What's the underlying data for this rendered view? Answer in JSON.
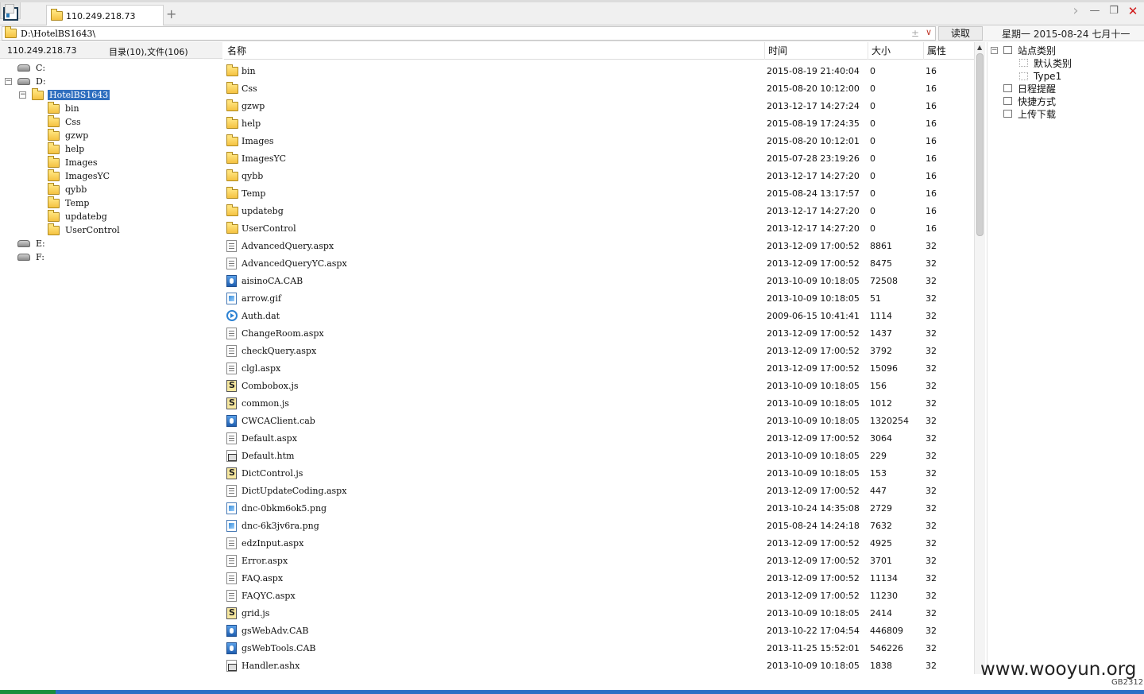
{
  "tab": {
    "title": "110.249.218.73"
  },
  "toolbar": {
    "new_tab": "+",
    "minimize": "—",
    "restore": "❐",
    "close": "✕",
    "forward": "›"
  },
  "address": {
    "path": "D:\\HotelBS1643\\",
    "star": "±",
    "dropdown": "∨",
    "read_label": "读取"
  },
  "date_line": "星期一  2015-08-24  七月十一",
  "left": {
    "host": "110.249.218.73",
    "counts": "目录(10),文件(106)",
    "tree": [
      {
        "label": "C:",
        "kind": "drive"
      },
      {
        "label": "D:",
        "kind": "drive",
        "expander": "−"
      },
      {
        "label": "HotelBS1643",
        "kind": "folder",
        "expander": "−",
        "selected": true
      },
      {
        "label": "bin",
        "kind": "folder"
      },
      {
        "label": "Css",
        "kind": "folder"
      },
      {
        "label": "gzwp",
        "kind": "folder"
      },
      {
        "label": "help",
        "kind": "folder"
      },
      {
        "label": "Images",
        "kind": "folder"
      },
      {
        "label": "ImagesYC",
        "kind": "folder"
      },
      {
        "label": "qybb",
        "kind": "folder"
      },
      {
        "label": "Temp",
        "kind": "folder"
      },
      {
        "label": "updatebg",
        "kind": "folder"
      },
      {
        "label": "UserControl",
        "kind": "folder"
      },
      {
        "label": "E:",
        "kind": "drive"
      },
      {
        "label": "F:",
        "kind": "drive"
      }
    ]
  },
  "columns": {
    "name": "名称",
    "time": "时间",
    "size": "大小",
    "attr": "属性"
  },
  "files": [
    {
      "name": "bin",
      "icon": "folder",
      "time": "2015-08-19 21:40:04",
      "size": "0",
      "attr": "16"
    },
    {
      "name": "Css",
      "icon": "folder",
      "time": "2015-08-20 10:12:00",
      "size": "0",
      "attr": "16"
    },
    {
      "name": "gzwp",
      "icon": "folder",
      "time": "2013-12-17 14:27:24",
      "size": "0",
      "attr": "16"
    },
    {
      "name": "help",
      "icon": "folder",
      "time": "2015-08-19 17:24:35",
      "size": "0",
      "attr": "16"
    },
    {
      "name": "Images",
      "icon": "folder",
      "time": "2015-08-20 10:12:01",
      "size": "0",
      "attr": "16"
    },
    {
      "name": "ImagesYC",
      "icon": "folder",
      "time": "2015-07-28 23:19:26",
      "size": "0",
      "attr": "16"
    },
    {
      "name": "qybb",
      "icon": "folder",
      "time": "2013-12-17 14:27:20",
      "size": "0",
      "attr": "16"
    },
    {
      "name": "Temp",
      "icon": "folder",
      "time": "2015-08-24 13:17:57",
      "size": "0",
      "attr": "16"
    },
    {
      "name": "updatebg",
      "icon": "folder",
      "time": "2013-12-17 14:27:20",
      "size": "0",
      "attr": "16"
    },
    {
      "name": "UserControl",
      "icon": "folder",
      "time": "2013-12-17 14:27:20",
      "size": "0",
      "attr": "16"
    },
    {
      "name": "AdvancedQuery.aspx",
      "icon": "aspx",
      "time": "2013-12-09 17:00:52",
      "size": "8861",
      "attr": "32"
    },
    {
      "name": "AdvancedQueryYC.aspx",
      "icon": "aspx",
      "time": "2013-12-09 17:00:52",
      "size": "8475",
      "attr": "32"
    },
    {
      "name": "aisinoCA.CAB",
      "icon": "cab",
      "time": "2013-10-09 10:18:05",
      "size": "72508",
      "attr": "32"
    },
    {
      "name": "arrow.gif",
      "icon": "img",
      "time": "2013-10-09 10:18:05",
      "size": "51",
      "attr": "32"
    },
    {
      "name": "Auth.dat",
      "icon": "dat",
      "time": "2009-06-15 10:41:41",
      "size": "1114",
      "attr": "32"
    },
    {
      "name": "ChangeRoom.aspx",
      "icon": "aspx",
      "time": "2013-12-09 17:00:52",
      "size": "1437",
      "attr": "32"
    },
    {
      "name": "checkQuery.aspx",
      "icon": "aspx",
      "time": "2013-12-09 17:00:52",
      "size": "3792",
      "attr": "32"
    },
    {
      "name": "clgl.aspx",
      "icon": "aspx",
      "time": "2013-12-09 17:00:52",
      "size": "15096",
      "attr": "32"
    },
    {
      "name": "Combobox.js",
      "icon": "js",
      "time": "2013-10-09 10:18:05",
      "size": "156",
      "attr": "32"
    },
    {
      "name": "common.js",
      "icon": "js",
      "time": "2013-10-09 10:18:05",
      "size": "1012",
      "attr": "32"
    },
    {
      "name": "CWCAClient.cab",
      "icon": "cab",
      "time": "2013-10-09 10:18:05",
      "size": "1320254",
      "attr": "32"
    },
    {
      "name": "Default.aspx",
      "icon": "aspx",
      "time": "2013-12-09 17:00:52",
      "size": "3064",
      "attr": "32"
    },
    {
      "name": "Default.htm",
      "icon": "htm",
      "time": "2013-10-09 10:18:05",
      "size": "229",
      "attr": "32"
    },
    {
      "name": "DictControl.js",
      "icon": "js",
      "time": "2013-10-09 10:18:05",
      "size": "153",
      "attr": "32"
    },
    {
      "name": "DictUpdateCoding.aspx",
      "icon": "aspx",
      "time": "2013-12-09 17:00:52",
      "size": "447",
      "attr": "32"
    },
    {
      "name": "dnc-0bkm6ok5.png",
      "icon": "img",
      "time": "2013-10-24 14:35:08",
      "size": "2729",
      "attr": "32"
    },
    {
      "name": "dnc-6k3jv6ra.png",
      "icon": "img",
      "time": "2015-08-24 14:24:18",
      "size": "7632",
      "attr": "32"
    },
    {
      "name": "edzInput.aspx",
      "icon": "aspx",
      "time": "2013-12-09 17:00:52",
      "size": "4925",
      "attr": "32"
    },
    {
      "name": "Error.aspx",
      "icon": "aspx",
      "time": "2013-12-09 17:00:52",
      "size": "3701",
      "attr": "32"
    },
    {
      "name": "FAQ.aspx",
      "icon": "aspx",
      "time": "2013-12-09 17:00:52",
      "size": "11134",
      "attr": "32"
    },
    {
      "name": "FAQYC.aspx",
      "icon": "aspx",
      "time": "2013-12-09 17:00:52",
      "size": "11230",
      "attr": "32"
    },
    {
      "name": "grid.js",
      "icon": "js",
      "time": "2013-10-09 10:18:05",
      "size": "2414",
      "attr": "32"
    },
    {
      "name": "gsWebAdv.CAB",
      "icon": "cab",
      "time": "2013-10-22 17:04:54",
      "size": "446809",
      "attr": "32"
    },
    {
      "name": "gsWebTools.CAB",
      "icon": "cab",
      "time": "2013-11-25 15:52:01",
      "size": "546226",
      "attr": "32"
    },
    {
      "name": "Handler.ashx",
      "icon": "htm",
      "time": "2013-10-09 10:18:05",
      "size": "1838",
      "attr": "32"
    }
  ],
  "right": {
    "items": [
      {
        "label": "站点类别",
        "expander": "−"
      },
      {
        "label": "默认类别"
      },
      {
        "label": "Type1"
      },
      {
        "label": "日程提醒"
      },
      {
        "label": "快捷方式"
      },
      {
        "label": "上传下载"
      }
    ]
  },
  "watermark": "www.wooyun.org",
  "encoding": "GB2312"
}
